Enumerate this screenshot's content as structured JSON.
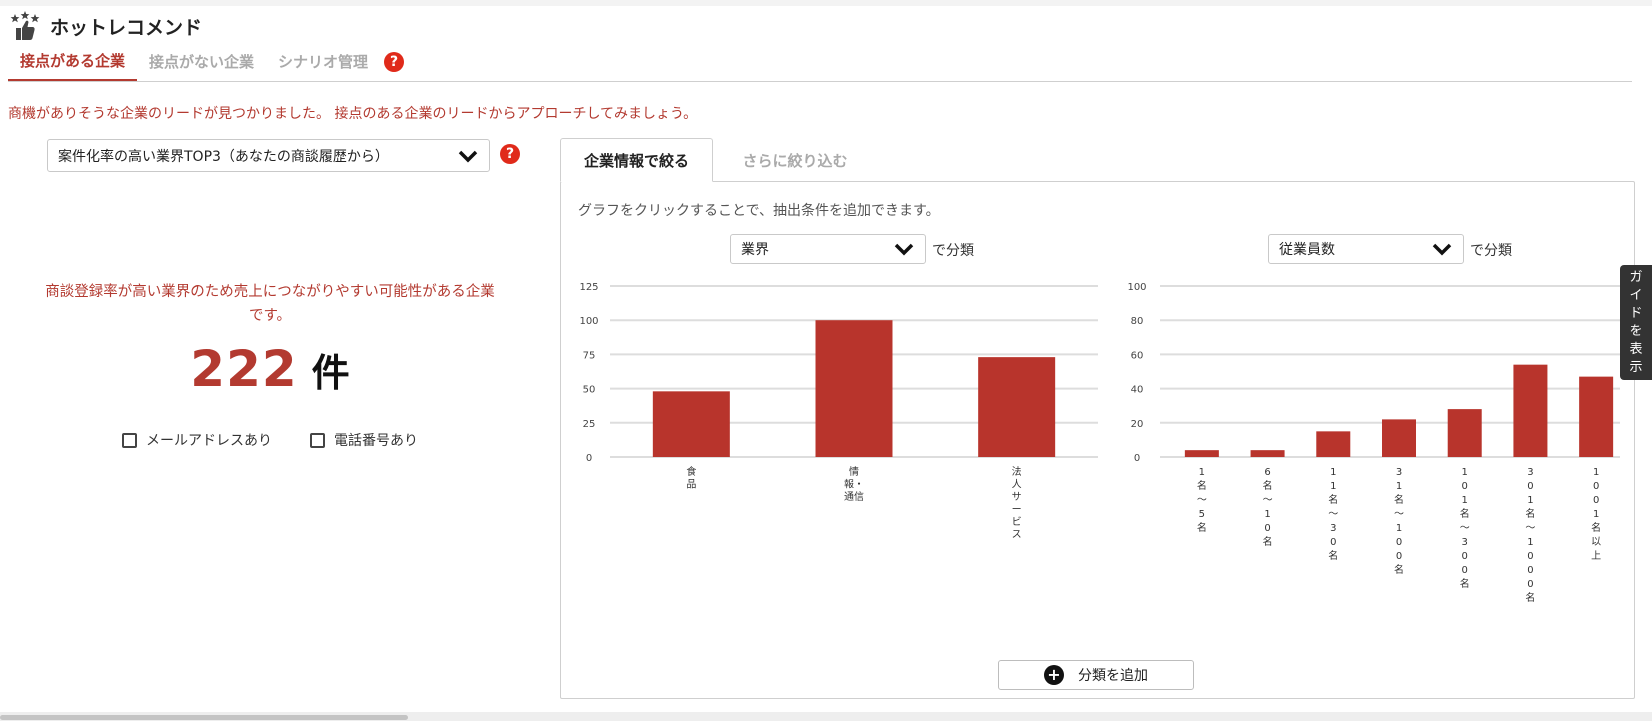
{
  "header": {
    "title": "ホットレコメンド",
    "logo_icon": "stars-thumb-icon"
  },
  "tabs": [
    {
      "label": "接点がある企業",
      "active": true
    },
    {
      "label": "接点がない企業",
      "active": false
    },
    {
      "label": "シナリオ管理",
      "active": false
    }
  ],
  "help_symbol": "?",
  "intro": "商機がありそうな企業のリードが見つかりました。 接点のある企業のリードからアプローチしてみましょう。",
  "scenario": {
    "selected": "案件化率の高い業界TOP3（あなたの商談履歴から）"
  },
  "summary": {
    "description": "商談登録率が高い業界のため売上につながりやすい可能性がある企業です。",
    "count": "222",
    "unit": "件"
  },
  "filters": [
    {
      "label": "メールアドレスあり",
      "checked": false
    },
    {
      "label": "電話番号あり",
      "checked": false
    }
  ],
  "panel": {
    "tabs": [
      {
        "label": "企業情報で絞る",
        "active": true
      },
      {
        "label": "さらに絞り込む",
        "active": false
      }
    ],
    "hint": "グラフをクリックすることで、抽出条件を追加できます。",
    "classify_suffix": "で分類",
    "add_button": "分類を追加"
  },
  "guide": [
    "ガ",
    "イ",
    "ド",
    "を",
    "表",
    "示"
  ],
  "colors": {
    "accent": "#b33a30",
    "bar": "#b8342c",
    "help": "#e02a1a"
  },
  "chart_data": [
    {
      "type": "bar",
      "selector": "業界",
      "categories": [
        "食品",
        "情報・通信",
        "法人サービス"
      ],
      "category_lines": [
        [
          "食",
          "品"
        ],
        [
          "情",
          "報・",
          "通信"
        ],
        [
          "法",
          "人",
          "サ",
          "ー",
          "ビ",
          "ス"
        ]
      ],
      "values": [
        48,
        100,
        73
      ],
      "ylim": [
        0,
        125
      ],
      "yticks": [
        "0",
        "25",
        "50",
        "75",
        "100",
        "125"
      ],
      "grid": true
    },
    {
      "type": "bar",
      "selector": "従業員数",
      "categories": [
        "1名〜5名",
        "6名〜10名",
        "11名〜30名",
        "31名〜100名",
        "101名〜300名",
        "301名〜1000名",
        "1001名以上"
      ],
      "category_lines": [
        [
          "1",
          "名",
          "〜",
          "5",
          "名"
        ],
        [
          "6",
          "名",
          "〜",
          "1",
          "0",
          "名"
        ],
        [
          "1",
          "1",
          "名",
          "〜",
          "3",
          "0",
          "名"
        ],
        [
          "3",
          "1",
          "名",
          "〜",
          "1",
          "0",
          "0",
          "名"
        ],
        [
          "1",
          "0",
          "1",
          "名",
          "〜",
          "3",
          "0",
          "0",
          "名"
        ],
        [
          "3",
          "0",
          "1",
          "名",
          "〜",
          "1",
          "0",
          "0",
          "0",
          "名"
        ],
        [
          "1",
          "0",
          "0",
          "1",
          "名",
          "以",
          "上"
        ]
      ],
      "values": [
        4,
        4,
        15,
        22,
        28,
        54,
        47
      ],
      "ylim": [
        0,
        100
      ],
      "yticks": [
        "0",
        "20",
        "40",
        "60",
        "80",
        "100"
      ],
      "grid": true
    }
  ]
}
